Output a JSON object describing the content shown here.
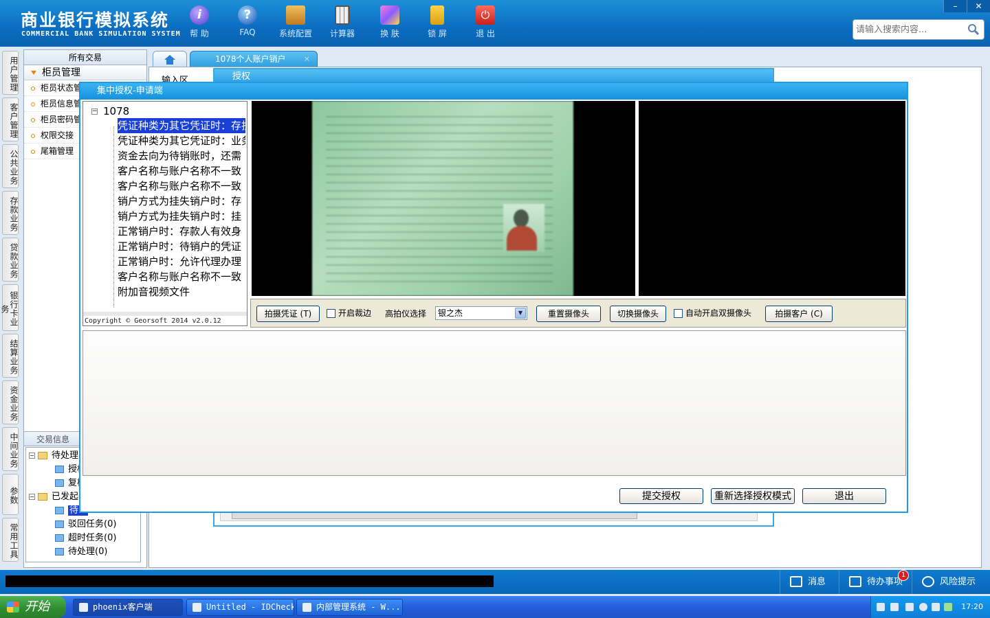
{
  "header": {
    "title_cn": "商业银行模拟系统",
    "title_en": "COMMERCIAL BANK SIMULATION SYSTEM",
    "tools": [
      {
        "label": "帮 助",
        "icon": "info-icon"
      },
      {
        "label": "FAQ",
        "icon": "question-icon"
      },
      {
        "label": "系统配置",
        "icon": "toolbox-icon"
      },
      {
        "label": "计算器",
        "icon": "calculator-icon"
      },
      {
        "label": "换 肤",
        "icon": "shirt-icon"
      },
      {
        "label": "锁 屏",
        "icon": "lock-icon"
      },
      {
        "label": "退 出",
        "icon": "power-icon"
      }
    ],
    "search_placeholder": "请输入搜索内容...",
    "win_min": "–",
    "win_close": "✕"
  },
  "leftnav": [
    "用户管理",
    "客户管理",
    "公共业务",
    "存款业务",
    "贷款业务",
    "银行卡业务",
    "结算业务",
    "资金业务",
    "中间业务",
    "参数",
    "常用工具"
  ],
  "leftpanel": {
    "title": "所有交易",
    "group": "柜员管理",
    "items": [
      "柜员状态管理",
      "柜员信息管理",
      "柜员密码管理",
      "权限交接",
      "尾箱管理"
    ],
    "trade_info_title": "交易信息",
    "tree": {
      "pending": "待处理",
      "auth": "授权",
      "review": "复核",
      "sent": "已发起",
      "wait": "待...",
      "returned": "驳回任务(0)",
      "timeout": "超时任务(0)",
      "todo": "待处理(0)"
    }
  },
  "tabs": {
    "active": "1078个人账户销户",
    "close": "×"
  },
  "main": {
    "input_area": "输入区"
  },
  "authwin": {
    "title": "授权"
  },
  "dialog": {
    "title": "集中授权-申请端",
    "tree_root": "1078",
    "tree_items": [
      "凭证种类为其它凭证时：存折",
      "凭证种类为其它凭证时：业务",
      "资金去向为待销账时，还需",
      "客户名称与账户名称不一致",
      "客户名称与账户名称不一致",
      "销户方式为挂失销户时：存",
      "销户方式为挂失销户时：挂",
      "正常销户时：存款人有效身",
      "正常销户时：待销户的凭证",
      "正常销户时：允许代理办理",
      "客户名称与账户名称不一致",
      "附加音视频文件"
    ],
    "copyright": "Copyright © Georsoft 2014 v2.0.12",
    "controls": {
      "capture_voucher": "拍摄凭证 (T)",
      "enable_crop": "开启裁边",
      "scanner_select_label": "高拍仪选择",
      "scanner_value": "银之杰",
      "reset_camera": "重置摄像头",
      "switch_camera": "切换摄像头",
      "auto_dual": "自动开启双摄像头",
      "capture_customer": "拍摄客户 (C)"
    },
    "buttons": {
      "submit": "提交授权",
      "reselect": "重新选择授权模式",
      "exit": "退出"
    }
  },
  "statusbar": {
    "message": "消息",
    "todo": "待办事项",
    "todo_badge": "1",
    "risk": "风险提示"
  },
  "taskbar": {
    "start": "开始",
    "tasks": [
      "phoenix客户端",
      "Untitled - IDCheck",
      "内部管理系统 - W..."
    ],
    "clock": "17:20"
  }
}
